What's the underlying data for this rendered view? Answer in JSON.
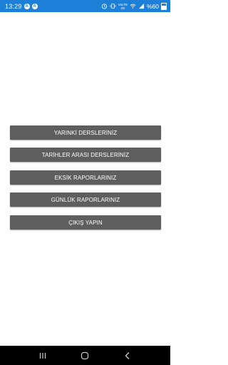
{
  "status_bar": {
    "time": "13:29",
    "notifications": [
      "A",
      "A"
    ],
    "network_label_top": "VoLTE",
    "network_label_bottom": "4G",
    "battery_text": "%60",
    "icons": [
      "alarm-icon",
      "vibrate-icon",
      "wifi-icon",
      "signal-icon",
      "battery-icon"
    ]
  },
  "menu": {
    "items": [
      {
        "label": "YARINKİ DERSLERİNİZ"
      },
      {
        "label": "TARİHLER ARASI DERSLERİNİZ"
      },
      {
        "label": "EKSİK RAPORLARINIZ"
      },
      {
        "label": "GÜNLÜK RAPORLARINIZ"
      },
      {
        "label": "ÇIKIŞ YAPIN"
      }
    ]
  },
  "nav_bar": {
    "icons": [
      "recent-apps-icon",
      "home-icon",
      "back-icon"
    ]
  },
  "colors": {
    "status_bar": "#1e7fd9",
    "button": "#5e5e5e",
    "button_text": "#ffffff",
    "nav_bar": "#000000"
  }
}
